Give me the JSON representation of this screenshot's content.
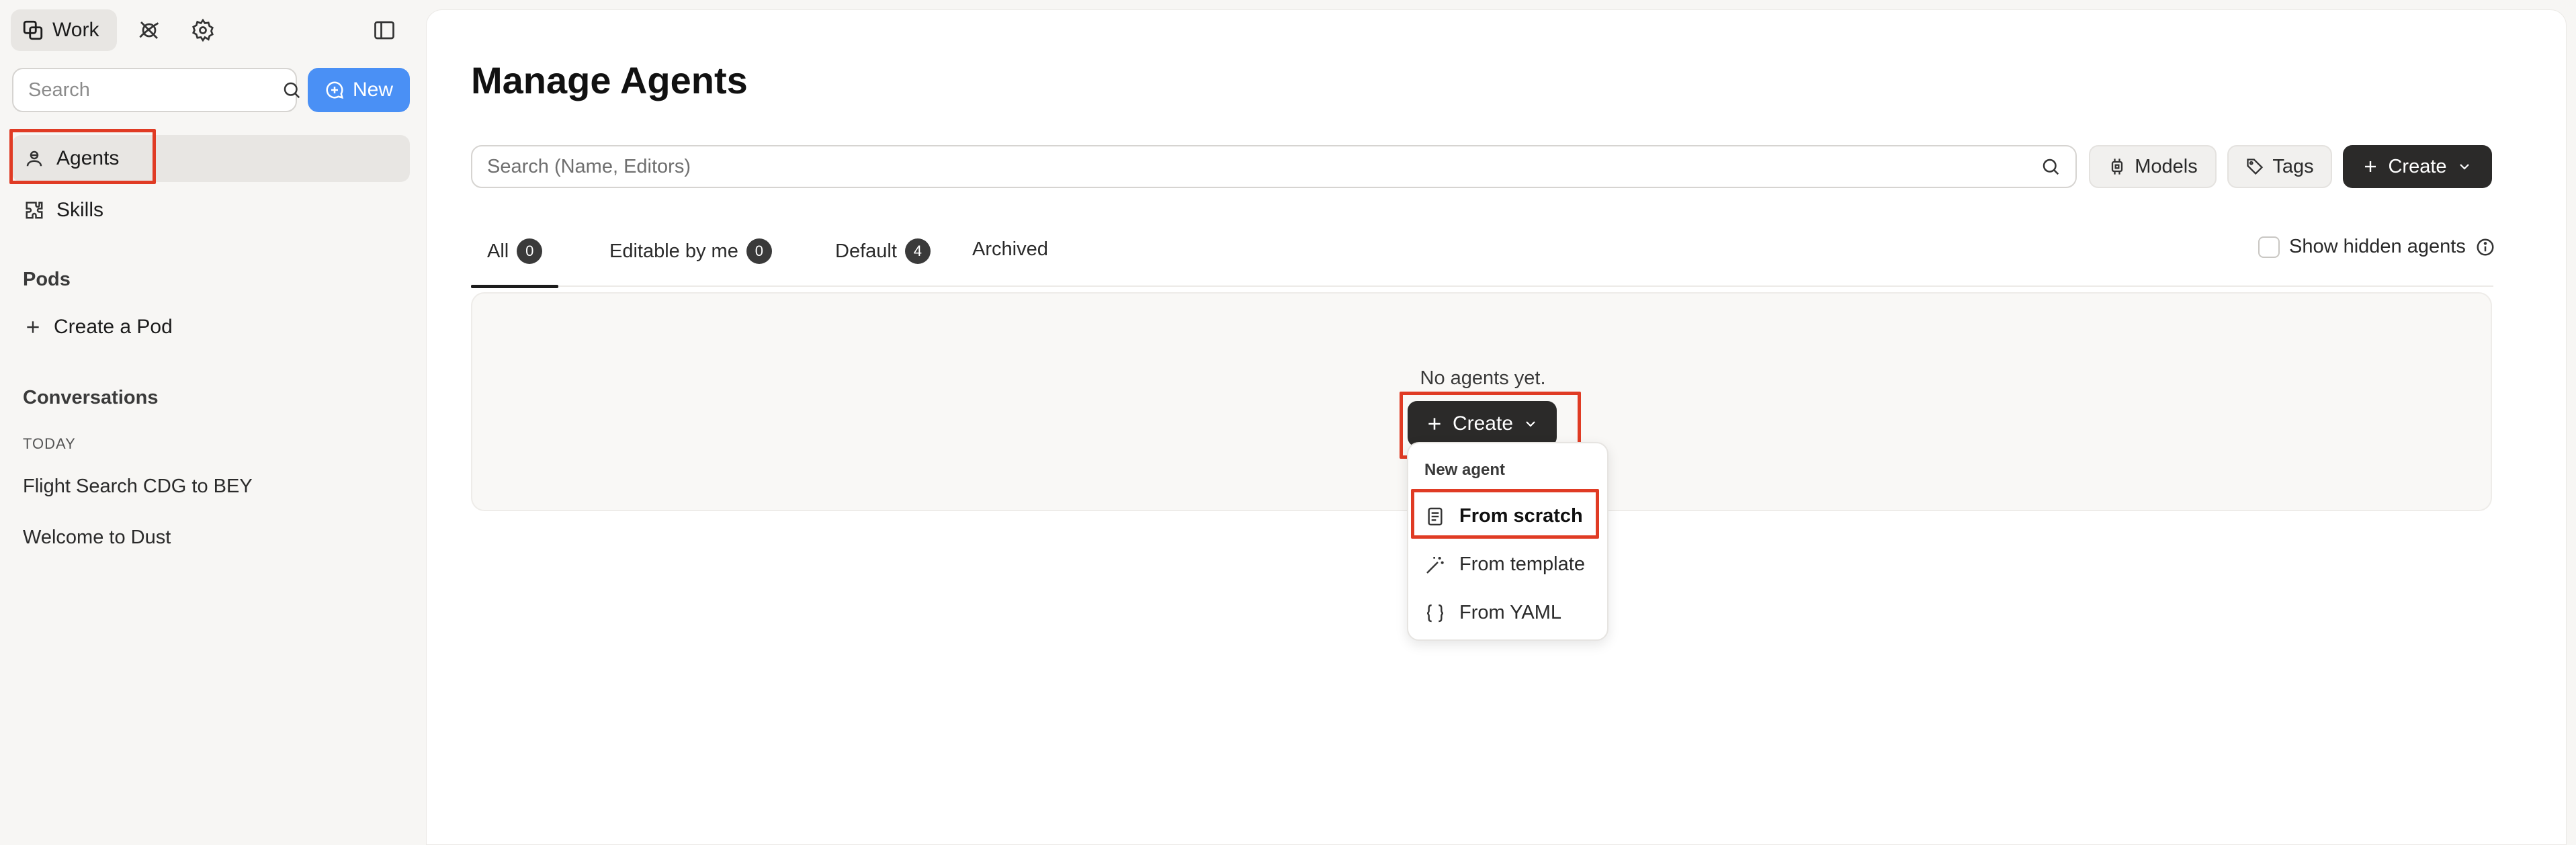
{
  "sidebar": {
    "workspace_label": "Work",
    "search": {
      "placeholder": "Search"
    },
    "new_button": "New",
    "nav": [
      {
        "label": "Agents",
        "icon": "agent-icon",
        "active": true
      },
      {
        "label": "Skills",
        "icon": "puzzle-icon",
        "active": false
      }
    ],
    "pods": {
      "title": "Pods",
      "create_label": "Create a Pod"
    },
    "conversations": {
      "title": "Conversations",
      "group_label": "TODAY",
      "items": [
        "Flight Search CDG to BEY",
        "Welcome to Dust"
      ]
    }
  },
  "main": {
    "title": "Manage Agents",
    "search": {
      "placeholder": "Search (Name, Editors)"
    },
    "models_button": "Models",
    "tags_button": "Tags",
    "create_button": "Create",
    "tabs": [
      {
        "label": "All",
        "count": "0",
        "active": true
      },
      {
        "label": "Editable by me",
        "count": "0",
        "active": false
      },
      {
        "label": "Default",
        "count": "4",
        "active": false
      },
      {
        "label": "Archived",
        "count": null,
        "active": false
      }
    ],
    "show_hidden_label": "Show hidden agents",
    "empty_state": {
      "message": "No agents yet.",
      "create_button": "Create"
    },
    "dropdown": {
      "header": "New agent",
      "items": [
        {
          "label": "From scratch",
          "icon": "document-icon"
        },
        {
          "label": "From template",
          "icon": "magic-wand-icon"
        },
        {
          "label": "From YAML",
          "icon": "braces-icon"
        }
      ]
    }
  },
  "colors": {
    "accent_blue": "#4a90f5",
    "dark_button": "#2b2a29",
    "highlight_red": "#e03b24"
  }
}
